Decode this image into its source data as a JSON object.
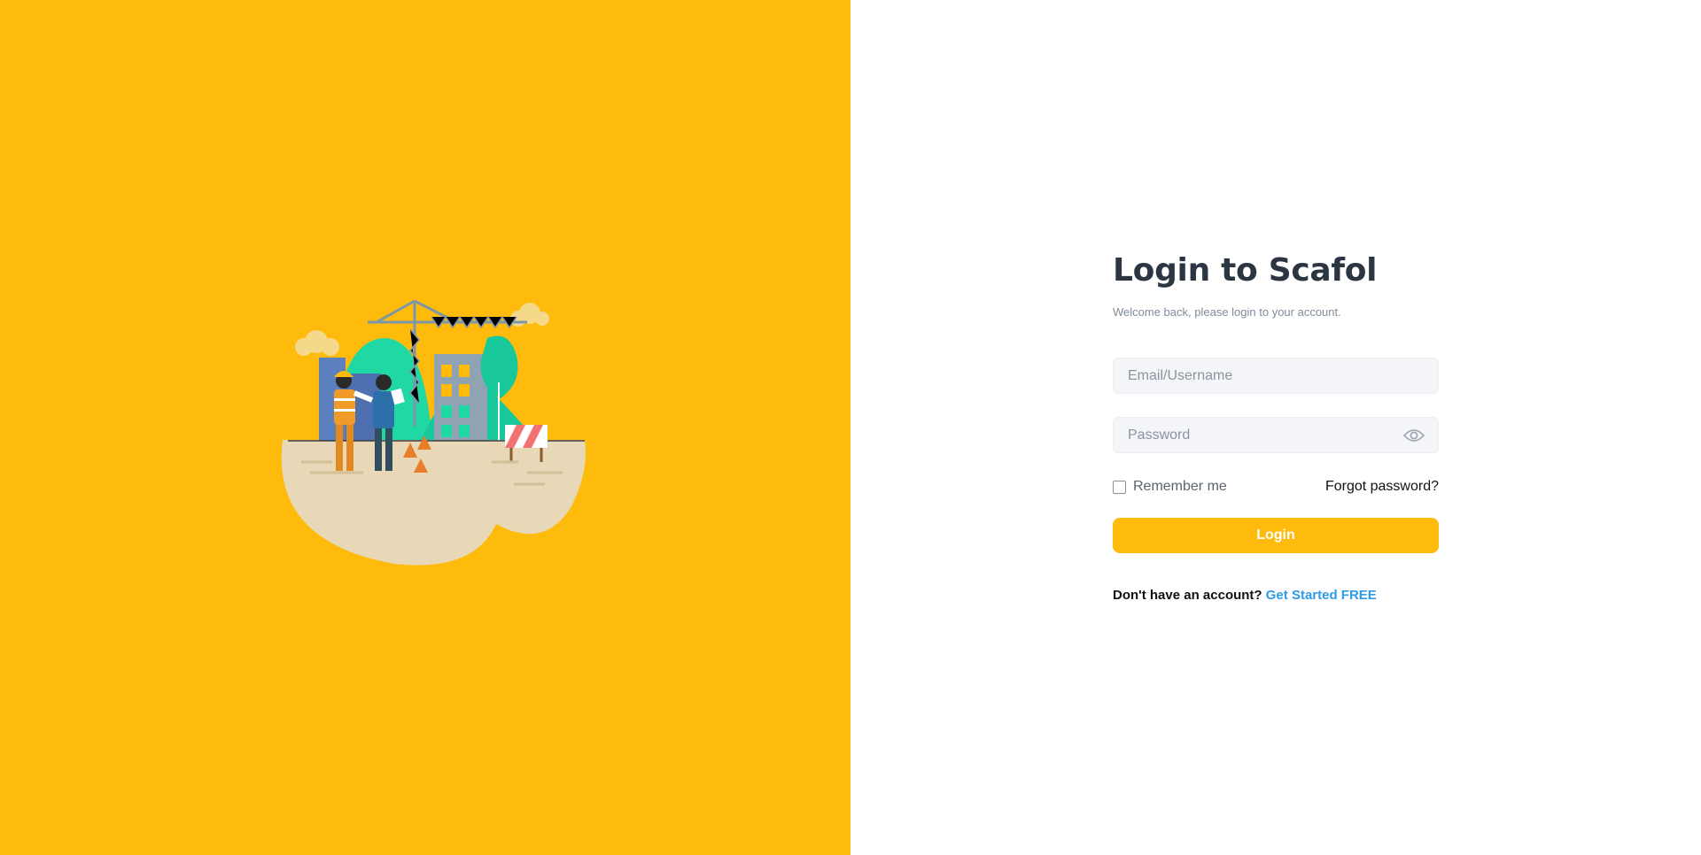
{
  "login": {
    "title": "Login to Scafol",
    "subtitle": "Welcome back, please login to your account.",
    "email_placeholder": "Email/Username",
    "password_placeholder": "Password",
    "remember_label": "Remember me",
    "forgot_label": "Forgot password?",
    "button_label": "Login",
    "signup_prompt": "Don't have an account?",
    "signup_link": "Get Started FREE"
  },
  "colors": {
    "accent": "#FFBB0B",
    "title": "#2b3642",
    "link": "#2e9be6"
  },
  "icons": {
    "password_toggle": "eye-icon",
    "illustration": "construction-site-illustration"
  }
}
